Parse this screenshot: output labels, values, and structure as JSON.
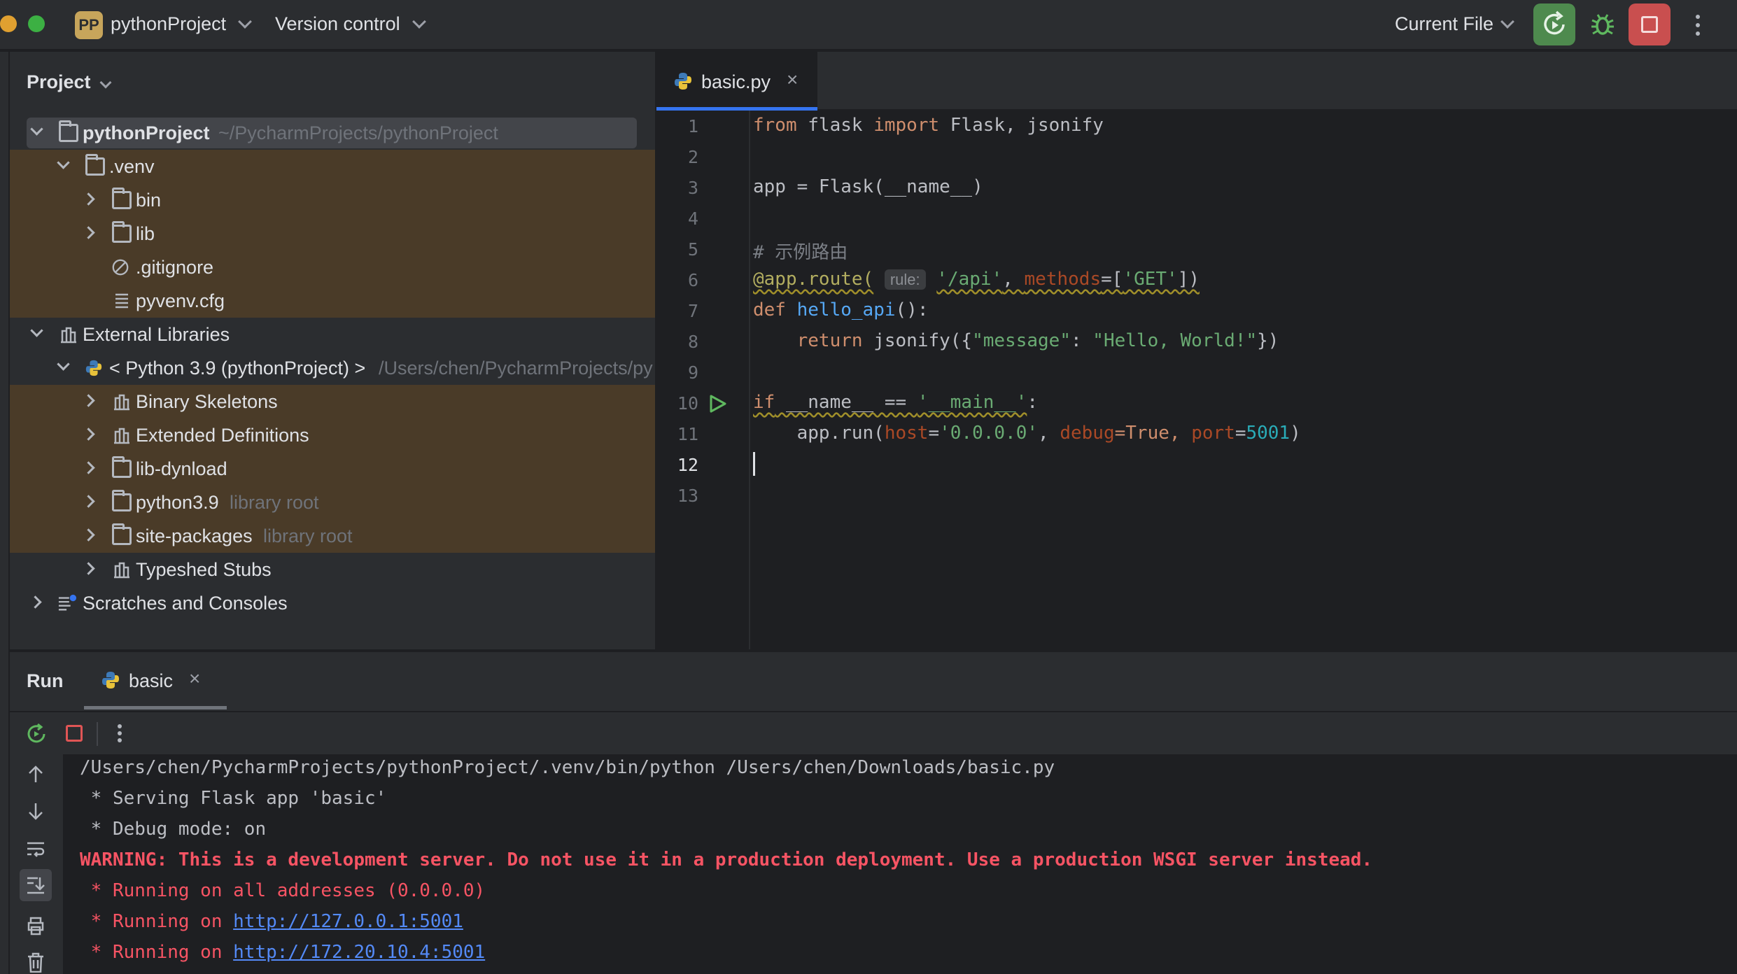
{
  "titlebar": {
    "project_badge": "PP",
    "project_name": "pythonProject",
    "version_control": "Version control",
    "run_config": "Current File",
    "colors": {
      "rerun": "#4e8a4e",
      "stop": "#c94f4f",
      "badge": "#c7a55b"
    }
  },
  "project_panel": {
    "title": "Project",
    "tree": [
      {
        "label": "pythonProject",
        "hint": "~/PycharmProjects/pythonProject"
      },
      {
        "label": ".venv"
      },
      {
        "label": "bin"
      },
      {
        "label": "lib"
      },
      {
        "label": ".gitignore"
      },
      {
        "label": "pyvenv.cfg"
      },
      {
        "label": "External Libraries"
      },
      {
        "label": "< Python 3.9 (pythonProject) >",
        "hint": "/Users/chen/PycharmProjects/py"
      },
      {
        "label": "Binary Skeletons"
      },
      {
        "label": "Extended Definitions"
      },
      {
        "label": "lib-dynload"
      },
      {
        "label": "python3.9",
        "hint": "library root"
      },
      {
        "label": "site-packages",
        "hint": "library root"
      },
      {
        "label": "Typeshed Stubs"
      },
      {
        "label": "Scratches and Consoles"
      }
    ]
  },
  "editor": {
    "tab_label": "basic.py",
    "line_numbers": [
      "1",
      "2",
      "3",
      "4",
      "5",
      "6",
      "7",
      "8",
      "9",
      "10",
      "11",
      "12",
      "13"
    ],
    "code": {
      "l1": [
        "from",
        " flask ",
        "import",
        " Flask, jsonify"
      ],
      "l3": "app = Flask(__name__)",
      "l5": "# 示例路由",
      "l6": [
        "@app.route(",
        "rule:",
        "'/api'",
        ", ",
        "methods",
        "=[",
        "'GET'",
        "])"
      ],
      "l7": [
        "def",
        " ",
        "hello_api",
        "():"
      ],
      "l8": [
        "    ",
        "return",
        " jsonify({",
        "\"message\"",
        ": ",
        "\"Hello, World!\"",
        "})"
      ],
      "l10": [
        "if",
        " __name__ == ",
        "'__main__'",
        ":"
      ],
      "l11": [
        "    app.run(",
        "host",
        "=",
        "'0.0.0.0'",
        ", ",
        "debug",
        "=True, ",
        "port",
        "=",
        "5001",
        ")"
      ]
    }
  },
  "run_panel": {
    "title": "Run",
    "tab_label": "basic",
    "console": {
      "cmd": "/Users/chen/PycharmProjects/pythonProject/.venv/bin/python /Users/chen/Downloads/basic.py",
      "serving": " * Serving Flask app 'basic'",
      "debug": " * Debug mode: on",
      "warning": "WARNING: This is a development server. Do not use it in a production deployment. Use a production WSGI server instead.",
      "running_all": " * Running on all addresses (0.0.0.0)",
      "running_prefix": " * Running on ",
      "url_local": "http://127.0.0.1:5001",
      "url_net": "http://172.20.10.4:5001"
    }
  }
}
